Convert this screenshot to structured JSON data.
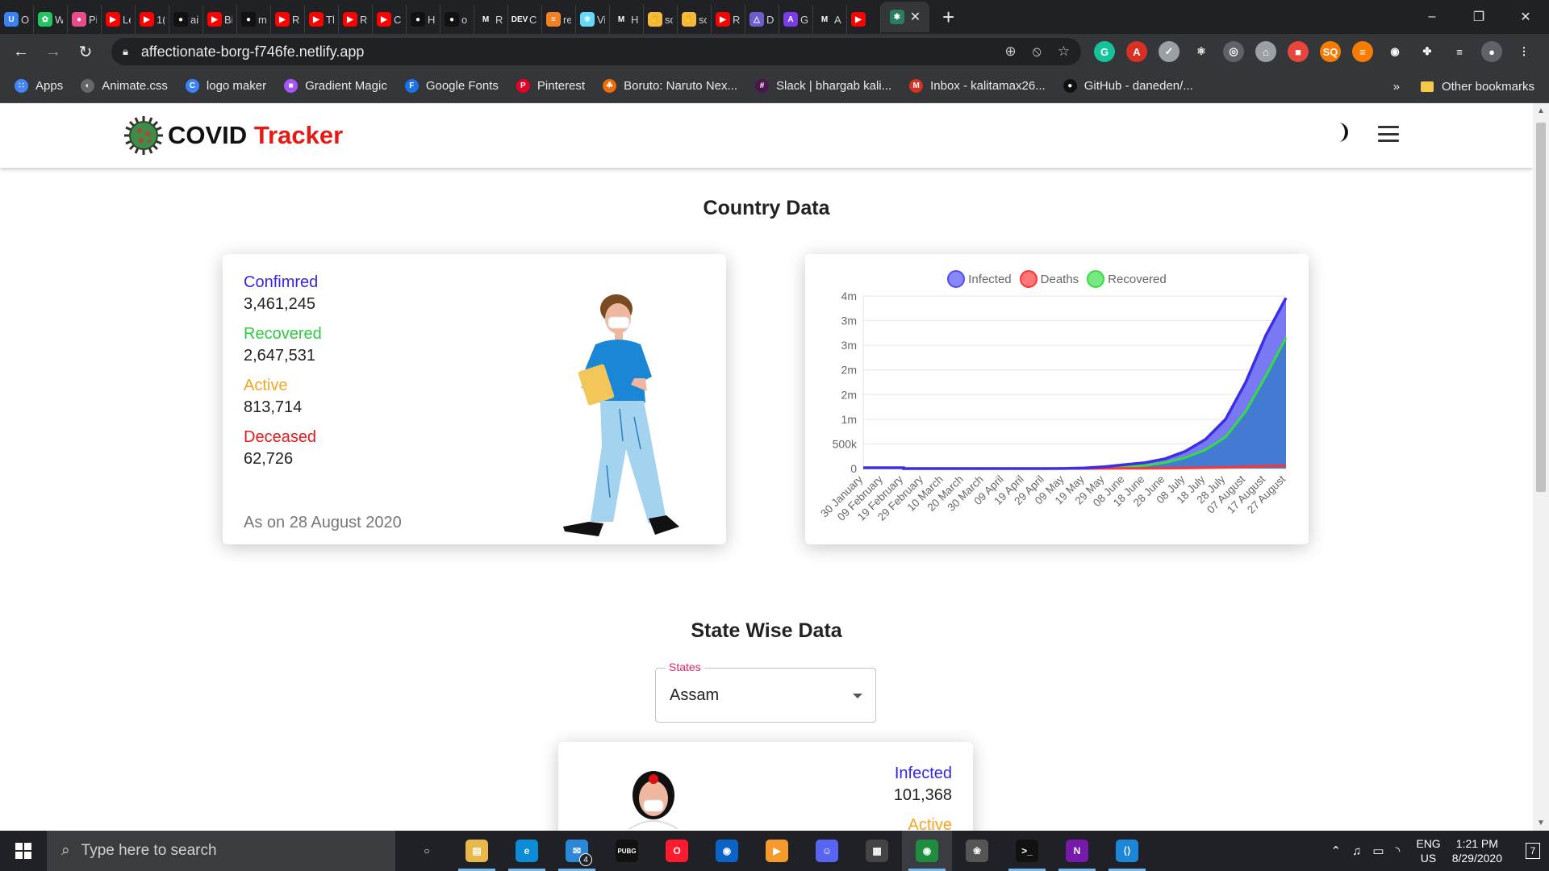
{
  "browser": {
    "tabs": [
      {
        "t": "O",
        "c": "#3b82f6",
        "g": "U"
      },
      {
        "t": "W",
        "c": "#22c55e",
        "g": "✿"
      },
      {
        "t": "Pi",
        "c": "#ea4c89",
        "g": "●"
      },
      {
        "t": "Le",
        "c": "#ff0000",
        "g": "▶"
      },
      {
        "t": "1(",
        "c": "#ff0000",
        "g": "▶"
      },
      {
        "t": "ai",
        "c": "#111111",
        "g": "●"
      },
      {
        "t": "Bi",
        "c": "#ff0000",
        "g": "▶"
      },
      {
        "t": "m",
        "c": "#111111",
        "g": "●"
      },
      {
        "t": "R",
        "c": "#ff0000",
        "g": "▶"
      },
      {
        "t": "Tl",
        "c": "#ff0000",
        "g": "▶"
      },
      {
        "t": "R",
        "c": "#ff0000",
        "g": "▶"
      },
      {
        "t": "C",
        "c": "#ff0000",
        "g": "▶"
      },
      {
        "t": "H",
        "c": "#111111",
        "g": "●"
      },
      {
        "t": "o",
        "c": "#111111",
        "g": "●"
      },
      {
        "t": "R",
        "c": "#202124",
        "g": "M"
      },
      {
        "t": "C",
        "c": "#202124",
        "g": "DEV"
      },
      {
        "t": "re",
        "c": "#f48024",
        "g": "≡"
      },
      {
        "t": "Vi",
        "c": "#61dafb",
        "g": "⚛"
      },
      {
        "t": "H",
        "c": "#202124",
        "g": "M"
      },
      {
        "t": "sc",
        "c": "#f6b93b",
        "g": "✋"
      },
      {
        "t": "sc",
        "c": "#f6b93b",
        "g": "✋"
      },
      {
        "t": "R",
        "c": "#ff0000",
        "g": "▶"
      },
      {
        "t": "D",
        "c": "#6d5bd0",
        "g": "△"
      },
      {
        "t": "G",
        "c": "#7c3aed",
        "g": "A"
      },
      {
        "t": "A",
        "c": "#202124",
        "g": "M"
      },
      {
        "t": "",
        "c": "#ff0000",
        "g": "▶"
      }
    ],
    "active_tab_close": "✕",
    "new_tab": "+",
    "window_controls": [
      "–",
      "❐",
      "✕"
    ],
    "url": "affectionate-borg-f746fe.netlify.app",
    "omni_icons": [
      "⊕",
      "⦸",
      "☆"
    ],
    "extensions": [
      {
        "g": "G",
        "c": "#15c39a"
      },
      {
        "g": "A",
        "c": "#d93025"
      },
      {
        "g": "✓",
        "c": "#9aa0a6"
      },
      {
        "g": "⚛",
        "c": "#35363a"
      },
      {
        "g": "◎",
        "c": "#5f6368"
      },
      {
        "g": "⌂",
        "c": "#9aa0a6"
      },
      {
        "g": "■",
        "c": "#e8453c"
      },
      {
        "g": "SQ",
        "c": "#f57c00"
      },
      {
        "g": "≡",
        "c": "#f57c00"
      },
      {
        "g": "◉",
        "c": "#35363a"
      },
      {
        "g": "✤",
        "c": "#35363a"
      },
      {
        "g": "≡",
        "c": "#35363a"
      },
      {
        "g": "●",
        "c": "#5f6368"
      },
      {
        "g": "⋮",
        "c": "#35363a"
      }
    ],
    "bookmarks": [
      {
        "label": "Apps",
        "c": "#4285f4",
        "g": "∷"
      },
      {
        "label": "Animate.css",
        "c": "#666666",
        "g": "◐"
      },
      {
        "label": "logo maker",
        "c": "#3b82f6",
        "g": "C"
      },
      {
        "label": "Gradient Magic",
        "c": "#a855f7",
        "g": "■"
      },
      {
        "label": "Google Fonts",
        "c": "#1a73e8",
        "g": "F"
      },
      {
        "label": "Pinterest",
        "c": "#e60023",
        "g": "P"
      },
      {
        "label": "Boruto: Naruto Nex...",
        "c": "#ef6c00",
        "g": "☘"
      },
      {
        "label": "Slack | bhargab kali...",
        "c": "#4a154b",
        "g": "#"
      },
      {
        "label": "Inbox - kalitamax26...",
        "c": "#d93025",
        "g": "M"
      },
      {
        "label": "GitHub - daneden/...",
        "c": "#111111",
        "g": "●"
      }
    ],
    "bookmarks_overflow": "»",
    "other_bookmarks": "Other bookmarks"
  },
  "app": {
    "brand_plain": "COVID",
    "brand_accent": "Tracker",
    "country_title": "Country Data",
    "stats": [
      {
        "label": "Confimred",
        "value": "3,461,245",
        "color": "#3525e8"
      },
      {
        "label": "Recovered",
        "value": "2,647,531",
        "color": "#2ecc40"
      },
      {
        "label": "Active",
        "value": "813,714",
        "color": "#f5a524"
      },
      {
        "label": "Deceased",
        "value": "62,726",
        "color": "#e11b1b"
      }
    ],
    "as_on": "As on 28 August 2020",
    "state_title": "State Wise Data",
    "select_label": "States",
    "select_value": "Assam",
    "state_card": {
      "label": "Infected",
      "value": "101,368",
      "label_color": "#3525e8",
      "next_label": "Active"
    }
  },
  "chart_data": {
    "type": "area",
    "title": "",
    "legend_position": "top",
    "series": [
      {
        "name": "Infected",
        "color": "#4d4dff",
        "values": [
          1,
          3,
          3,
          3,
          3,
          3,
          3,
          200,
          1100,
          12000,
          38000,
          80000,
          120000,
          200000,
          350000,
          590000,
          1000000,
          1750000,
          2700000,
          3460000
        ]
      },
      {
        "name": "Deaths",
        "color": "#ff3333",
        "values": [
          0,
          0,
          0,
          0,
          0,
          0,
          0,
          10,
          40,
          400,
          1250,
          2700,
          3900,
          6300,
          10000,
          16000,
          24000,
          35000,
          49000,
          62700
        ]
      },
      {
        "name": "Recovered",
        "color": "#33dd44",
        "values": [
          0,
          0,
          2,
          3,
          3,
          3,
          3,
          20,
          100,
          1700,
          10000,
          30000,
          60000,
          120000,
          220000,
          380000,
          640000,
          1160000,
          1880000,
          2650000
        ]
      }
    ],
    "x": [
      "30 January",
      "09 February",
      "19 February",
      "29 February",
      "10 March",
      "20 March",
      "30 March",
      "09 April",
      "19 April",
      "29 April",
      "09 May",
      "19 May",
      "29 May",
      "08 June",
      "18 June",
      "28 June",
      "08 July",
      "18 July",
      "28 July",
      "07 August",
      "17 August",
      "27 August"
    ],
    "y_ticks": [
      {
        "label": "4m",
        "v": 3500000
      },
      {
        "label": "3m",
        "v": 3000000
      },
      {
        "label": "3m",
        "v": 2500000
      },
      {
        "label": "2m",
        "v": 2000000
      },
      {
        "label": "2m",
        "v": 1500000
      },
      {
        "label": "1m",
        "v": 1000000
      },
      {
        "label": "500k",
        "v": 500000
      },
      {
        "label": "0",
        "v": 0
      }
    ],
    "ylim": [
      0,
      3500000
    ],
    "grid": true
  },
  "taskbar": {
    "search_placeholder": "Type here to search",
    "apps": [
      {
        "g": "○",
        "c": "transparent"
      },
      {
        "g": "▤",
        "c": "#e8b84a"
      },
      {
        "g": "e",
        "c": "#0c8bd6"
      },
      {
        "g": "✉",
        "c": "#2b88d8"
      },
      {
        "g": "PUBG",
        "c": "#111111"
      },
      {
        "g": "O",
        "c": "#ff1b2d"
      },
      {
        "g": "◉",
        "c": "#0a64c8"
      },
      {
        "g": "▶",
        "c": "#f59b2b"
      },
      {
        "g": "☺",
        "c": "#5865f2"
      },
      {
        "g": "▦",
        "c": "#444444"
      },
      {
        "g": "◉",
        "c": "#1e8e3e"
      },
      {
        "g": "❀",
        "c": "#555555"
      },
      {
        "g": ">_",
        "c": "#111111"
      },
      {
        "g": "N",
        "c": "#7719aa"
      },
      {
        "g": "⟨⟩",
        "c": "#1c87d8"
      }
    ],
    "mail_badge": "4",
    "tray_symbols": [
      "⌃",
      "♫",
      "▭",
      "◝"
    ],
    "lang_top": "ENG",
    "lang_bottom": "US",
    "time": "1:21 PM",
    "date": "8/29/2020",
    "notification": "7"
  }
}
